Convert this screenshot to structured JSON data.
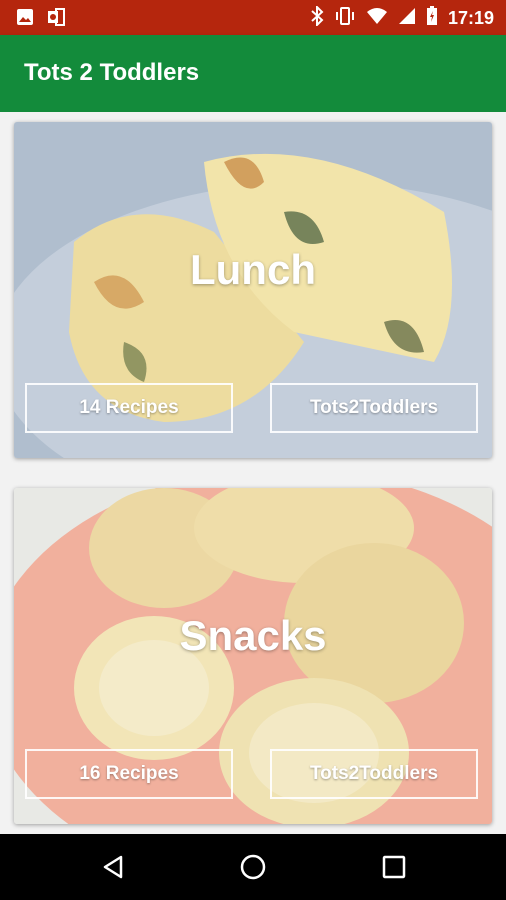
{
  "status_bar": {
    "time": "17:19",
    "icons": [
      "image-icon",
      "office-icon",
      "bluetooth-icon",
      "vibrate-icon",
      "wifi-icon",
      "signal-icon",
      "battery-icon"
    ]
  },
  "app_bar": {
    "title": "Tots 2 Toddlers",
    "color": "#138b3b"
  },
  "cards": [
    {
      "title": "Lunch",
      "recipes_label": "14 Recipes",
      "author_label": "Tots2Toddlers",
      "image": "pastry-on-blue-plate"
    },
    {
      "title": "Snacks",
      "recipes_label": "16 Recipes",
      "author_label": "Tots2Toddlers",
      "image": "muffins-on-pink-plate"
    }
  ],
  "nav_bar": {
    "icons": [
      "back-icon",
      "home-icon",
      "recents-icon"
    ]
  },
  "colors": {
    "status_bar": "#b5260d",
    "app_bar": "#138b3b",
    "nav_bar": "#000000"
  }
}
